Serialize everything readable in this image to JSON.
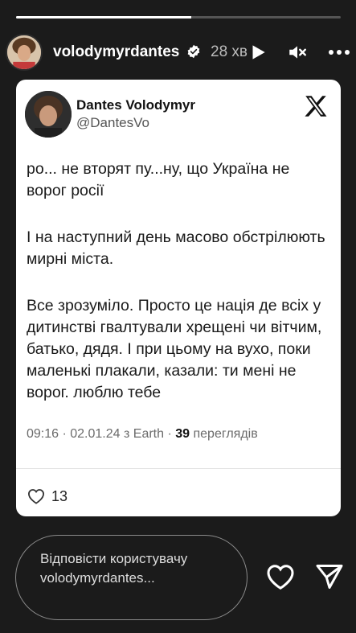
{
  "story": {
    "progress": 0.54,
    "username": "volodymyrdantes",
    "time": "28 хв"
  },
  "tweet": {
    "display_name": "Dantes Volodymyr",
    "handle": "@DantesVo",
    "paragraphs": [
      "ро... не вторят пу...ну, що Україна не ворог росії",
      "І на наступний день масово обстрілюють мирні міста.",
      "Все зрозуміло. Просто це нація де всіх у дитинстві гвалтували хрещені чи вітчим, батько, дядя. І при цьому на вухо, поки маленькі плакали,  казали: ти мені не ворог. люблю тебе"
    ],
    "meta_prefix": "09:16 · 02.01.24 з Earth · ",
    "views_count": "39",
    "views_label": " переглядів",
    "likes": "13"
  },
  "reply": {
    "placeholder": "Відповісти користувачу volodymyrdantes..."
  },
  "icons": {
    "verified": "verified-badge-icon",
    "play": "play-icon",
    "mute": "mute-icon",
    "more": "more-icon",
    "x_logo": "x-logo-icon",
    "like": "heart-outline-icon",
    "send": "send-icon"
  }
}
